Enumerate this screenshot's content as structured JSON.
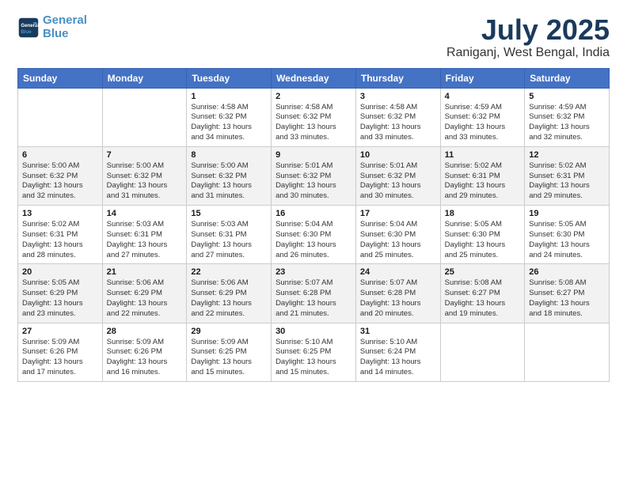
{
  "logo": {
    "line1": "General",
    "line2": "Blue"
  },
  "title": "July 2025",
  "location": "Raniganj, West Bengal, India",
  "weekdays": [
    "Sunday",
    "Monday",
    "Tuesday",
    "Wednesday",
    "Thursday",
    "Friday",
    "Saturday"
  ],
  "weeks": [
    [
      {
        "day": "",
        "details": ""
      },
      {
        "day": "",
        "details": ""
      },
      {
        "day": "1",
        "details": "Sunrise: 4:58 AM\nSunset: 6:32 PM\nDaylight: 13 hours\nand 34 minutes."
      },
      {
        "day": "2",
        "details": "Sunrise: 4:58 AM\nSunset: 6:32 PM\nDaylight: 13 hours\nand 33 minutes."
      },
      {
        "day": "3",
        "details": "Sunrise: 4:58 AM\nSunset: 6:32 PM\nDaylight: 13 hours\nand 33 minutes."
      },
      {
        "day": "4",
        "details": "Sunrise: 4:59 AM\nSunset: 6:32 PM\nDaylight: 13 hours\nand 33 minutes."
      },
      {
        "day": "5",
        "details": "Sunrise: 4:59 AM\nSunset: 6:32 PM\nDaylight: 13 hours\nand 32 minutes."
      }
    ],
    [
      {
        "day": "6",
        "details": "Sunrise: 5:00 AM\nSunset: 6:32 PM\nDaylight: 13 hours\nand 32 minutes."
      },
      {
        "day": "7",
        "details": "Sunrise: 5:00 AM\nSunset: 6:32 PM\nDaylight: 13 hours\nand 31 minutes."
      },
      {
        "day": "8",
        "details": "Sunrise: 5:00 AM\nSunset: 6:32 PM\nDaylight: 13 hours\nand 31 minutes."
      },
      {
        "day": "9",
        "details": "Sunrise: 5:01 AM\nSunset: 6:32 PM\nDaylight: 13 hours\nand 30 minutes."
      },
      {
        "day": "10",
        "details": "Sunrise: 5:01 AM\nSunset: 6:32 PM\nDaylight: 13 hours\nand 30 minutes."
      },
      {
        "day": "11",
        "details": "Sunrise: 5:02 AM\nSunset: 6:31 PM\nDaylight: 13 hours\nand 29 minutes."
      },
      {
        "day": "12",
        "details": "Sunrise: 5:02 AM\nSunset: 6:31 PM\nDaylight: 13 hours\nand 29 minutes."
      }
    ],
    [
      {
        "day": "13",
        "details": "Sunrise: 5:02 AM\nSunset: 6:31 PM\nDaylight: 13 hours\nand 28 minutes."
      },
      {
        "day": "14",
        "details": "Sunrise: 5:03 AM\nSunset: 6:31 PM\nDaylight: 13 hours\nand 27 minutes."
      },
      {
        "day": "15",
        "details": "Sunrise: 5:03 AM\nSunset: 6:31 PM\nDaylight: 13 hours\nand 27 minutes."
      },
      {
        "day": "16",
        "details": "Sunrise: 5:04 AM\nSunset: 6:30 PM\nDaylight: 13 hours\nand 26 minutes."
      },
      {
        "day": "17",
        "details": "Sunrise: 5:04 AM\nSunset: 6:30 PM\nDaylight: 13 hours\nand 25 minutes."
      },
      {
        "day": "18",
        "details": "Sunrise: 5:05 AM\nSunset: 6:30 PM\nDaylight: 13 hours\nand 25 minutes."
      },
      {
        "day": "19",
        "details": "Sunrise: 5:05 AM\nSunset: 6:30 PM\nDaylight: 13 hours\nand 24 minutes."
      }
    ],
    [
      {
        "day": "20",
        "details": "Sunrise: 5:05 AM\nSunset: 6:29 PM\nDaylight: 13 hours\nand 23 minutes."
      },
      {
        "day": "21",
        "details": "Sunrise: 5:06 AM\nSunset: 6:29 PM\nDaylight: 13 hours\nand 22 minutes."
      },
      {
        "day": "22",
        "details": "Sunrise: 5:06 AM\nSunset: 6:29 PM\nDaylight: 13 hours\nand 22 minutes."
      },
      {
        "day": "23",
        "details": "Sunrise: 5:07 AM\nSunset: 6:28 PM\nDaylight: 13 hours\nand 21 minutes."
      },
      {
        "day": "24",
        "details": "Sunrise: 5:07 AM\nSunset: 6:28 PM\nDaylight: 13 hours\nand 20 minutes."
      },
      {
        "day": "25",
        "details": "Sunrise: 5:08 AM\nSunset: 6:27 PM\nDaylight: 13 hours\nand 19 minutes."
      },
      {
        "day": "26",
        "details": "Sunrise: 5:08 AM\nSunset: 6:27 PM\nDaylight: 13 hours\nand 18 minutes."
      }
    ],
    [
      {
        "day": "27",
        "details": "Sunrise: 5:09 AM\nSunset: 6:26 PM\nDaylight: 13 hours\nand 17 minutes."
      },
      {
        "day": "28",
        "details": "Sunrise: 5:09 AM\nSunset: 6:26 PM\nDaylight: 13 hours\nand 16 minutes."
      },
      {
        "day": "29",
        "details": "Sunrise: 5:09 AM\nSunset: 6:25 PM\nDaylight: 13 hours\nand 15 minutes."
      },
      {
        "day": "30",
        "details": "Sunrise: 5:10 AM\nSunset: 6:25 PM\nDaylight: 13 hours\nand 15 minutes."
      },
      {
        "day": "31",
        "details": "Sunrise: 5:10 AM\nSunset: 6:24 PM\nDaylight: 13 hours\nand 14 minutes."
      },
      {
        "day": "",
        "details": ""
      },
      {
        "day": "",
        "details": ""
      }
    ]
  ],
  "row_colors": [
    "white",
    "gray",
    "white",
    "gray",
    "white"
  ]
}
